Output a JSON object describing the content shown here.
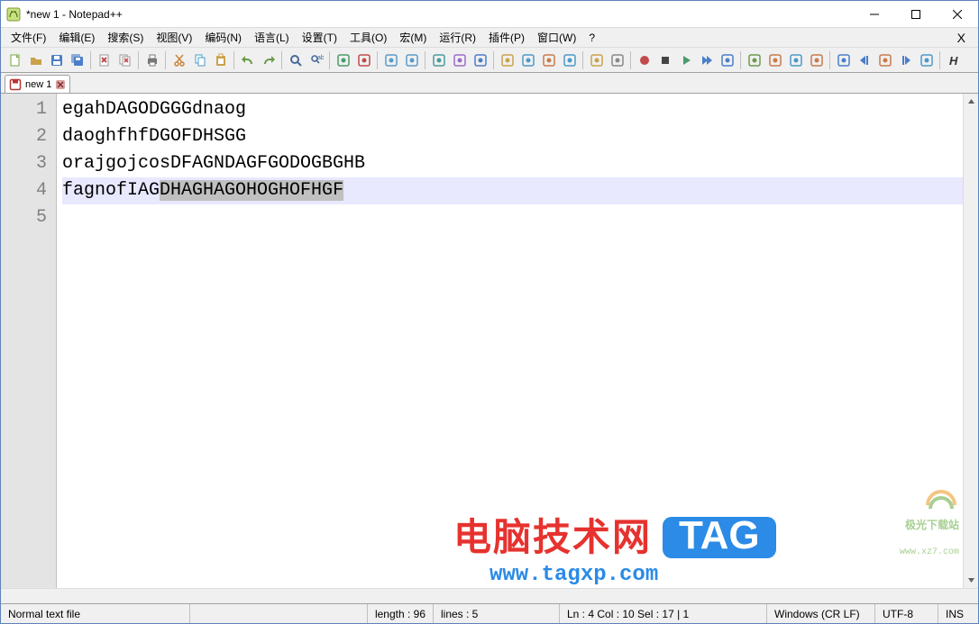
{
  "window": {
    "title": "*new 1 - Notepad++"
  },
  "menu": {
    "items": [
      "文件(F)",
      "编辑(E)",
      "搜索(S)",
      "视图(V)",
      "编码(N)",
      "语言(L)",
      "设置(T)",
      "工具(O)",
      "宏(M)",
      "运行(R)",
      "插件(P)",
      "窗口(W)",
      "?"
    ],
    "close_x": "X"
  },
  "tabs": {
    "items": [
      {
        "label": "new 1"
      }
    ]
  },
  "editor": {
    "lines": [
      "egahDAGODGGGdnaog",
      "daoghfhfDGOFDHSGG",
      "orajgojcosDFAGNDAGFGODOGBGHB",
      "fagnofIAGDHAGHAGOHOGHOFHGF",
      ""
    ],
    "line4_prefix": "fagnofIAG",
    "line4_selected": "DHAGHAGOHOGHOFHGF",
    "gutter": [
      "1",
      "2",
      "3",
      "4",
      "5"
    ]
  },
  "status": {
    "filetype": "Normal text file",
    "length_label": "length : 96",
    "lines_label": "lines : 5",
    "position": "Ln : 4    Col : 10    Sel : 17 | 1",
    "eol": "Windows (CR LF)",
    "encoding": "UTF-8",
    "mode": "INS"
  },
  "watermark": {
    "heading": "电脑技术网",
    "tag": "TAG",
    "url": "www.tagxp.com",
    "wm2_name": "极光下载站",
    "wm2_url": "www.xz7.com"
  },
  "toolbar_icons": [
    "new-file-icon",
    "open-file-icon",
    "save-icon",
    "save-all-icon",
    "sep",
    "close-icon",
    "close-all-icon",
    "sep",
    "print-icon",
    "sep",
    "cut-icon",
    "copy-icon",
    "paste-icon",
    "sep",
    "undo-icon",
    "redo-icon",
    "sep",
    "find-icon",
    "replace-icon",
    "sep",
    "zoom-in-icon",
    "zoom-out-icon",
    "sep",
    "sync-v-icon",
    "sync-h-icon",
    "sep",
    "wordwrap-icon",
    "all-chars-icon",
    "indent-guide-icon",
    "sep",
    "lang-udl-icon",
    "doc-map-icon",
    "doc-list-icon",
    "func-list-icon",
    "sep",
    "folder-icon",
    "monitoring-icon",
    "sep",
    "record-icon",
    "stop-icon",
    "play-icon",
    "playm-icon",
    "save-macro-icon",
    "sep",
    "spell-icon",
    "dspell1-icon",
    "dspell2-icon",
    "dspell3-icon",
    "sep",
    "compare-icon",
    "to-start-icon",
    "nav-icon",
    "to-end-icon",
    "clear-icon",
    "sep",
    "bold-icon"
  ],
  "toolbar_colors": {
    "new-file-icon": "#7aa646",
    "open-file-icon": "#c9a24a",
    "save-icon": "#4a7ec9",
    "save-all-icon": "#4a7ec9",
    "close-icon": "#c24a4a",
    "close-all-icon": "#c24a4a",
    "print-icon": "#777",
    "cut-icon": "#c9853a",
    "copy-icon": "#4a9ec9",
    "paste-icon": "#c9a24a",
    "undo-icon": "#6a9a4a",
    "redo-icon": "#6a9a4a",
    "find-icon": "#4a6a9a",
    "replace-icon": "#4a6a9a",
    "zoom-in-icon": "#4a9a6a",
    "zoom-out-icon": "#c24a4a",
    "sync-v-icon": "#5a9ac9",
    "sync-h-icon": "#5a9ac9",
    "wordwrap-icon": "#4a9a9a",
    "all-chars-icon": "#9a6ac9",
    "indent-guide-icon": "#4a7ec9",
    "lang-udl-icon": "#c9a24a",
    "doc-map-icon": "#4a9ac9",
    "doc-list-icon": "#c97a4a",
    "func-list-icon": "#4a9ac9",
    "folder-icon": "#c9a24a",
    "monitoring-icon": "#888",
    "record-icon": "#c24a4a",
    "stop-icon": "#444",
    "play-icon": "#4a9a6a",
    "playm-icon": "#4a7ec9",
    "save-macro-icon": "#4a7ec9",
    "spell-icon": "#6a9a4a",
    "dspell1-icon": "#c97a4a",
    "dspell2-icon": "#4a9ac9",
    "dspell3-icon": "#c97a4a",
    "compare-icon": "#4a7ec9",
    "to-start-icon": "#4a7ec9",
    "nav-icon": "#c97a4a",
    "to-end-icon": "#4a7ec9",
    "clear-icon": "#4a9ac9",
    "bold-icon": "#444"
  }
}
